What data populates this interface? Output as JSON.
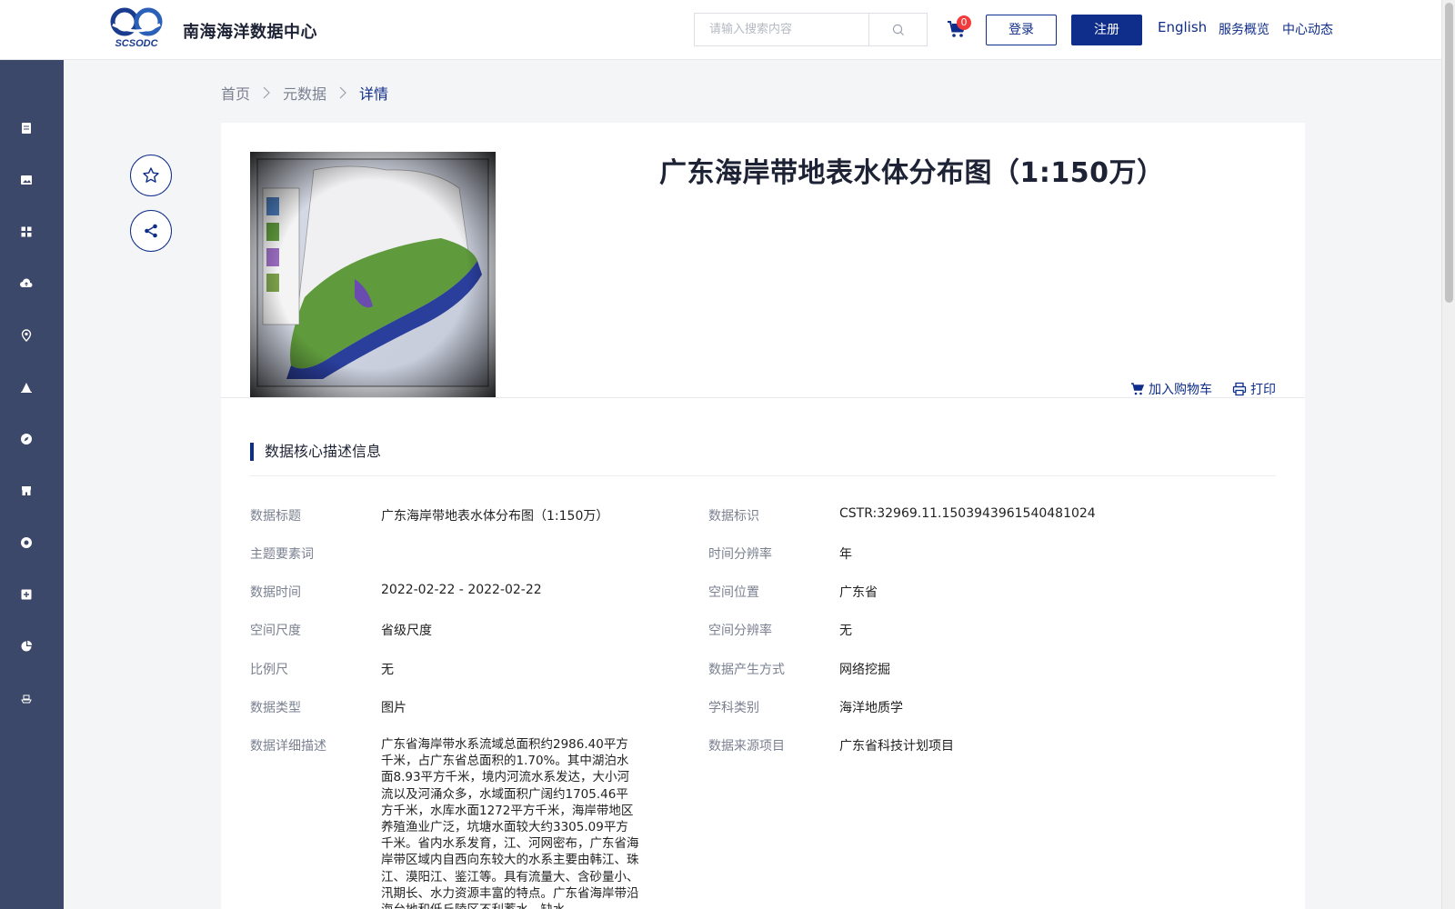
{
  "header": {
    "site_title": "南海海洋数据中心",
    "logo_text": "SCSODC",
    "search_placeholder": "请输入搜索内容",
    "cart_count": "0",
    "login_label": "登录",
    "register_label": "注册",
    "nav": [
      "English",
      "服务概览",
      "中心动态"
    ]
  },
  "sidebar": {
    "icons": [
      "document-icon",
      "image-icon",
      "grid-icon",
      "cloud-upload-icon",
      "location-pin-icon",
      "tent-icon",
      "compass-icon",
      "store-icon",
      "dashboard-icon",
      "add-square-icon",
      "pie-chart-icon",
      "boat-icon"
    ]
  },
  "breadcrumb": [
    "首页",
    "元数据",
    "详情"
  ],
  "detail": {
    "title": "广东海岸带地表水体分布图（1:150万）",
    "add_to_cart": "加入购物车",
    "print": "打印",
    "section_title": "数据核心描述信息"
  },
  "fields": {
    "left": [
      {
        "label": "数据标题",
        "value": "广东海岸带地表水体分布图（1:150万）"
      },
      {
        "label": "主题要素词",
        "value": ""
      },
      {
        "label": "数据时间",
        "value": "2022-02-22 - 2022-02-22"
      },
      {
        "label": "空间尺度",
        "value": "省级尺度"
      },
      {
        "label": "比例尺",
        "value": "无"
      },
      {
        "label": "数据类型",
        "value": "图片"
      },
      {
        "label": "数据详细描述",
        "value": "广东省海岸带水系流域总面积约2986.40平方千米，占广东省总面积的1.70%。其中湖泊水面8.93平方千米，境内河流水系发达，大小河流以及河涌众多，水域面积广阔约1705.46平方千米，水库水面1272平方千米，海岸带地区养殖渔业广泛，坑塘水面较大约3305.09平方千米。省内水系发育，江、河网密布，广东省海岸带区域内自西向东较大的水系主要由韩江、珠江、漠阳江、鉴江等。具有流量大、含砂量小、汛期长、水力资源丰富的特点。广东省海岸带沿海台地和低丘陵区不利蓄水，缺水"
      }
    ],
    "right": [
      {
        "label": "数据标识",
        "value": "CSTR:32969.11.1503943961540481024"
      },
      {
        "label": "时间分辨率",
        "value": "年"
      },
      {
        "label": "空间位置",
        "value": "广东省"
      },
      {
        "label": "空间分辨率",
        "value": "无"
      },
      {
        "label": "数据产生方式",
        "value": "网络挖掘"
      },
      {
        "label": "学科类别",
        "value": "海洋地质学"
      },
      {
        "label": "数据来源项目",
        "value": "广东省科技计划项目"
      }
    ]
  },
  "colors": {
    "brand": "#0f2d8a",
    "sidebar": "#3c4869",
    "badge": "#f33b3b"
  }
}
